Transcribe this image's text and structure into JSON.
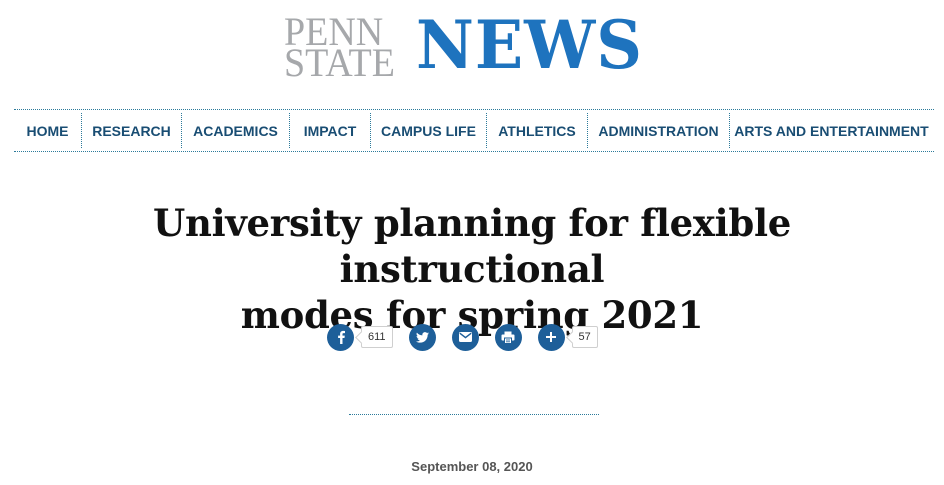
{
  "logo": {
    "line1": "PENN",
    "line2": "STATE",
    "wordmark": "NEWS",
    "primary_color": "#1e73be",
    "secondary_color": "#a6a8ab"
  },
  "nav": {
    "items": [
      {
        "label": "HOME"
      },
      {
        "label": "RESEARCH"
      },
      {
        "label": "ACADEMICS"
      },
      {
        "label": "IMPACT"
      },
      {
        "label": "CAMPUS LIFE"
      },
      {
        "label": "ATHLETICS"
      },
      {
        "label": "ADMINISTRATION"
      },
      {
        "label": "ARTS AND ENTERTAINMENT"
      }
    ]
  },
  "article": {
    "title_line1": "University planning for flexible instructional",
    "title_line2": "modes for spring 2021",
    "date": "September 08, 2020"
  },
  "share": {
    "facebook_icon": "facebook-icon",
    "facebook_count": "611",
    "twitter_icon": "twitter-icon",
    "email_icon": "email-icon",
    "print_icon": "print-icon",
    "more_icon": "plus-icon",
    "more_count": "57",
    "button_color": "#1e5f99"
  }
}
